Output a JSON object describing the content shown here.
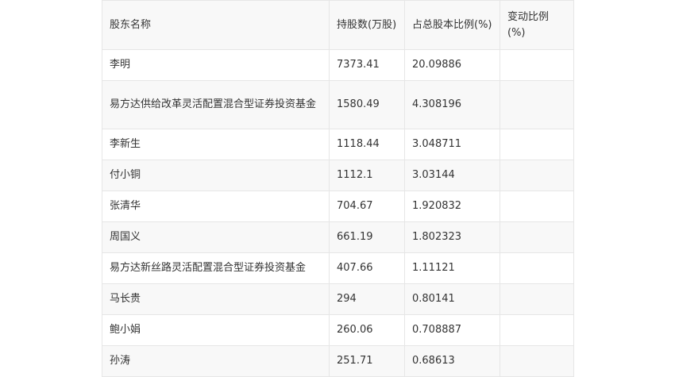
{
  "table": {
    "headers": [
      "股东名称",
      "持股数(万股)",
      "占总股本比例(%)",
      "变动比例(%)"
    ],
    "rows": [
      [
        "李明",
        "7373.41",
        "20.09886",
        ""
      ],
      [
        "易方达供给改革灵活配置混合型证券投资基金",
        "1580.49",
        "4.308196",
        ""
      ],
      [
        "李新生",
        "1118.44",
        "3.048711",
        ""
      ],
      [
        "付小铜",
        "1112.1",
        "3.03144",
        ""
      ],
      [
        "张清华",
        "704.67",
        "1.920832",
        ""
      ],
      [
        "周国义",
        "661.19",
        "1.802323",
        ""
      ],
      [
        "易方达新丝路灵活配置混合型证券投资基金",
        "407.66",
        "1.11121",
        ""
      ],
      [
        "马长贵",
        "294",
        "0.80141",
        ""
      ],
      [
        "鲍小娟",
        "260.06",
        "0.708887",
        ""
      ],
      [
        "孙涛",
        "251.71",
        "0.68613",
        ""
      ]
    ]
  }
}
